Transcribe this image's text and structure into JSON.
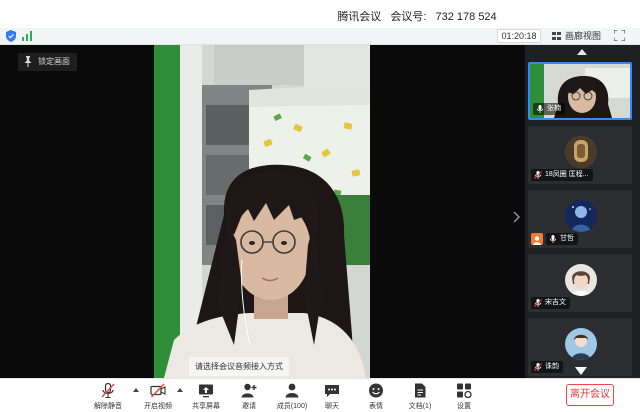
{
  "window": {
    "app_name": "腾讯会议",
    "meeting_id_label": "会议号:",
    "meeting_id": "732 178 524"
  },
  "status": {
    "timer": "01:20:18",
    "view_label": "画廊视图",
    "icons": [
      "shield-icon",
      "signal-icon",
      "gallery-grid-icon",
      "fullscreen-icon"
    ],
    "signal_color": "#27b35a"
  },
  "main": {
    "pin_label": "锁定画面",
    "audio_prompt": "请选择会议音频接入方式",
    "expand_icon": "chevron-right-icon"
  },
  "participants": [
    {
      "name": "张楠",
      "muted": false,
      "active": true
    },
    {
      "name": "18凤圈 匡程...",
      "muted": true,
      "active": false
    },
    {
      "name": "甘哲",
      "muted": false,
      "host": true,
      "active": false
    },
    {
      "name": "宋吉文",
      "muted": true,
      "active": false
    },
    {
      "name": "诛韵",
      "muted": true,
      "active": false
    }
  ],
  "toolbar": {
    "items": [
      {
        "label": "解除静音",
        "icon": "mic-muted-icon",
        "has_menu": true
      },
      {
        "label": "开启视频",
        "icon": "camera-off-icon",
        "has_menu": true
      },
      {
        "label": "共享屏幕",
        "icon": "share-screen-icon",
        "has_menu": false
      },
      {
        "label": "邀请",
        "icon": "invite-icon",
        "has_menu": false
      },
      {
        "label": "成员(100)",
        "icon": "members-icon",
        "has_menu": false
      },
      {
        "label": "聊天",
        "icon": "chat-icon",
        "has_menu": false
      },
      {
        "label": "表情",
        "icon": "emoji-icon",
        "has_menu": false
      },
      {
        "label": "文档(1)",
        "icon": "document-icon",
        "has_menu": false
      },
      {
        "label": "设置",
        "icon": "settings-icon",
        "has_menu": false
      }
    ],
    "leave_label": "离开会议",
    "accent_color": "#e84a4a"
  }
}
